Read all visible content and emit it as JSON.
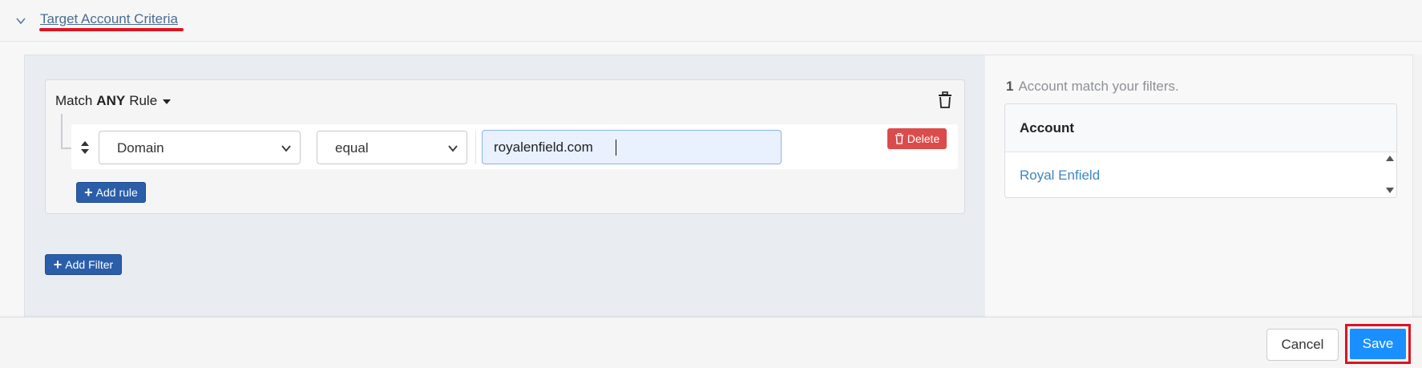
{
  "header": {
    "title": "Target Account Criteria",
    "chevron_icon": "chevron-down-icon"
  },
  "filter": {
    "match_prefix": "Match",
    "match_mode": "ANY",
    "match_suffix": "Rule",
    "rule": {
      "field": "Domain",
      "operator": "equal",
      "value": "royalenfield.com"
    },
    "delete_label": "Delete",
    "add_rule_label": "Add rule",
    "add_filter_label": "Add Filter"
  },
  "results": {
    "count": "1",
    "summary": "Account match your filters.",
    "column_header": "Account",
    "rows": [
      "Royal Enfield"
    ]
  },
  "footer": {
    "cancel_label": "Cancel",
    "save_label": "Save"
  },
  "colors": {
    "accent_blue": "#2b5ea9",
    "save_blue": "#1a8fff",
    "delete_red": "#dc4b4b",
    "highlight_red": "#e0131f",
    "link_blue": "#3d87c2"
  }
}
